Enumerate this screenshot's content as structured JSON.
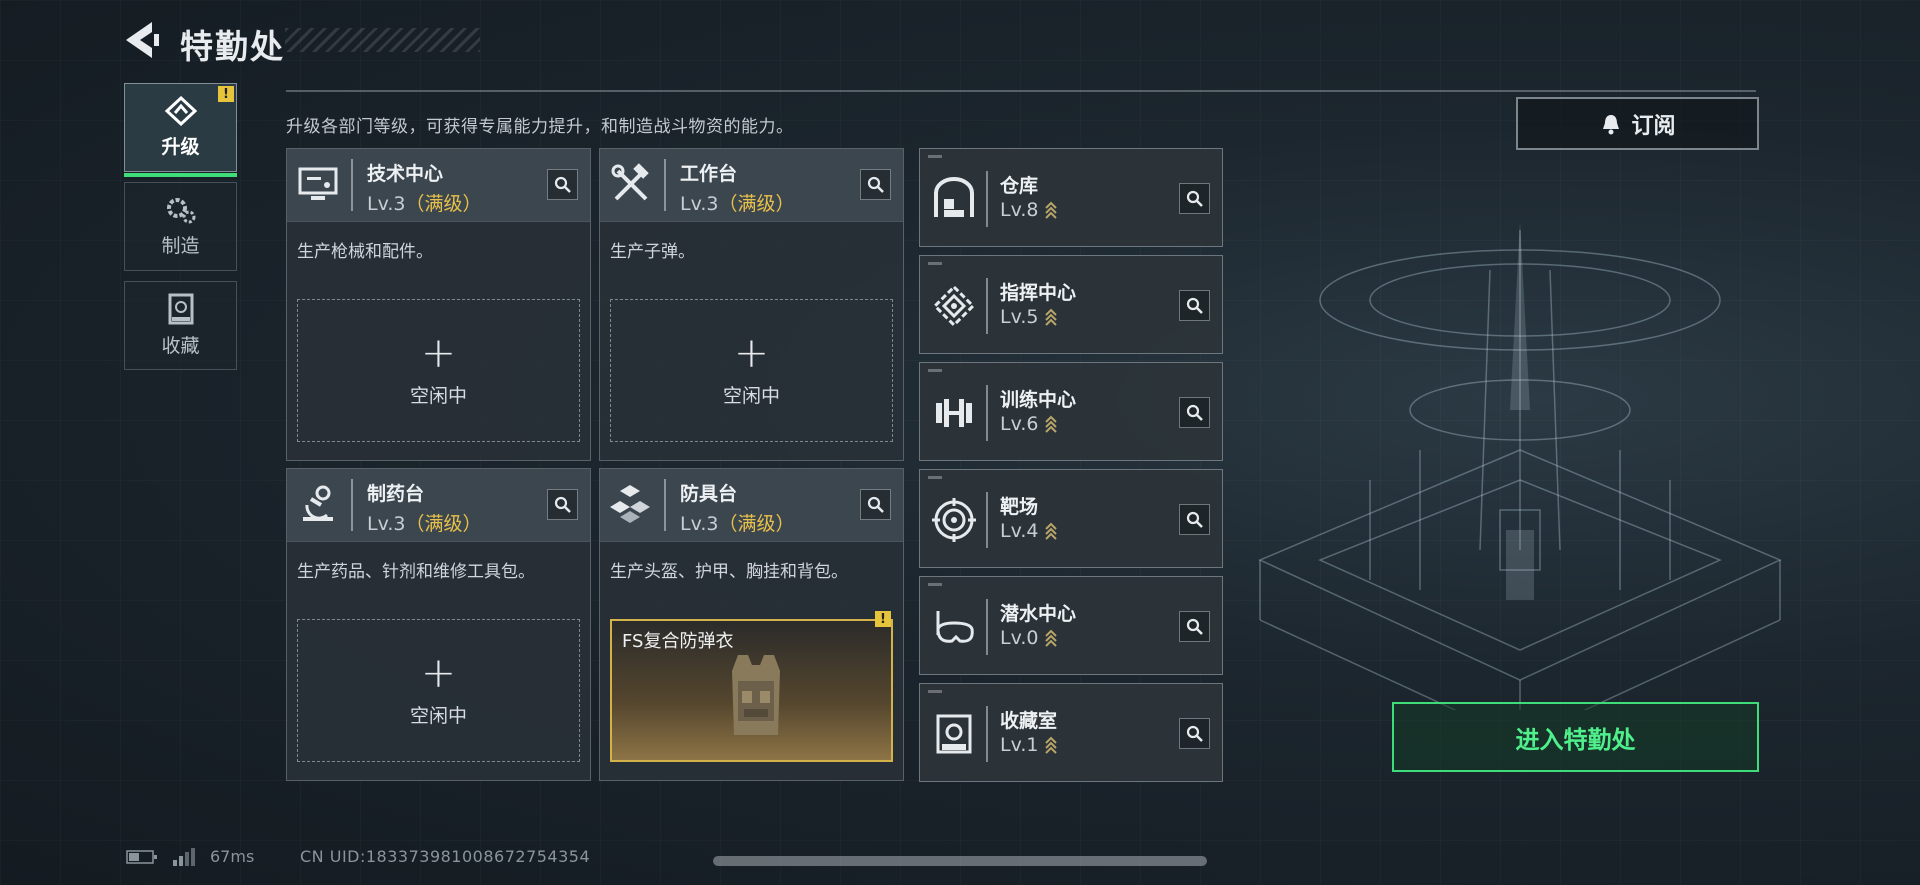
{
  "header": {
    "title": "特勤处"
  },
  "side_nav": [
    {
      "label": "升级",
      "icon": "upgrade-icon",
      "active": true,
      "badge": "!"
    },
    {
      "label": "制造",
      "icon": "gears-icon",
      "active": false
    },
    {
      "label": "收藏",
      "icon": "collection-icon",
      "active": false
    }
  ],
  "description": "升级各部门等级，可获得专属能力提升，和制造战斗物资的能力。",
  "subscribe_label": "订阅",
  "workstations": [
    {
      "name": "技术中心",
      "level": "Lv.3",
      "max_label": "（满级）",
      "icon": "monitor-icon",
      "desc": "生产枪械和配件。",
      "slot": {
        "type": "idle",
        "plus": "+",
        "label": "空闲中"
      }
    },
    {
      "name": "工作台",
      "level": "Lv.3",
      "max_label": "（满级）",
      "icon": "tools-icon",
      "desc": "生产子弹。",
      "slot": {
        "type": "idle",
        "plus": "+",
        "label": "空闲中"
      }
    },
    {
      "name": "制药台",
      "level": "Lv.3",
      "max_label": "（满级）",
      "icon": "microscope-icon",
      "desc": "生产药品、针剂和维修工具包。",
      "slot": {
        "type": "idle",
        "plus": "+",
        "label": "空闲中"
      }
    },
    {
      "name": "防具台",
      "level": "Lv.3",
      "max_label": "（满级）",
      "icon": "armor-blocks-icon",
      "desc": "生产头盔、护甲、胸挂和背包。",
      "slot": {
        "type": "item",
        "item_name": "FS复合防弹衣",
        "badge": "!"
      }
    }
  ],
  "facilities": [
    {
      "name": "仓库",
      "level": "Lv.8",
      "icon": "warehouse-icon"
    },
    {
      "name": "指挥中心",
      "level": "Lv.5",
      "icon": "command-icon"
    },
    {
      "name": "训练中心",
      "level": "Lv.6",
      "icon": "dumbbell-icon"
    },
    {
      "name": "靶场",
      "level": "Lv.4",
      "icon": "target-icon"
    },
    {
      "name": "潜水中心",
      "level": "Lv.0",
      "icon": "diving-mask-icon"
    },
    {
      "name": "收藏室",
      "level": "Lv.1",
      "icon": "vault-icon"
    }
  ],
  "enter_label": "进入特勤处",
  "status": {
    "ping": "67ms",
    "uid": "CN UID:1833739810086727543​54"
  },
  "colors": {
    "accent_green": "#3fdc7a",
    "max_gold": "#e8c04a",
    "warn_yellow": "#e6c43c"
  }
}
